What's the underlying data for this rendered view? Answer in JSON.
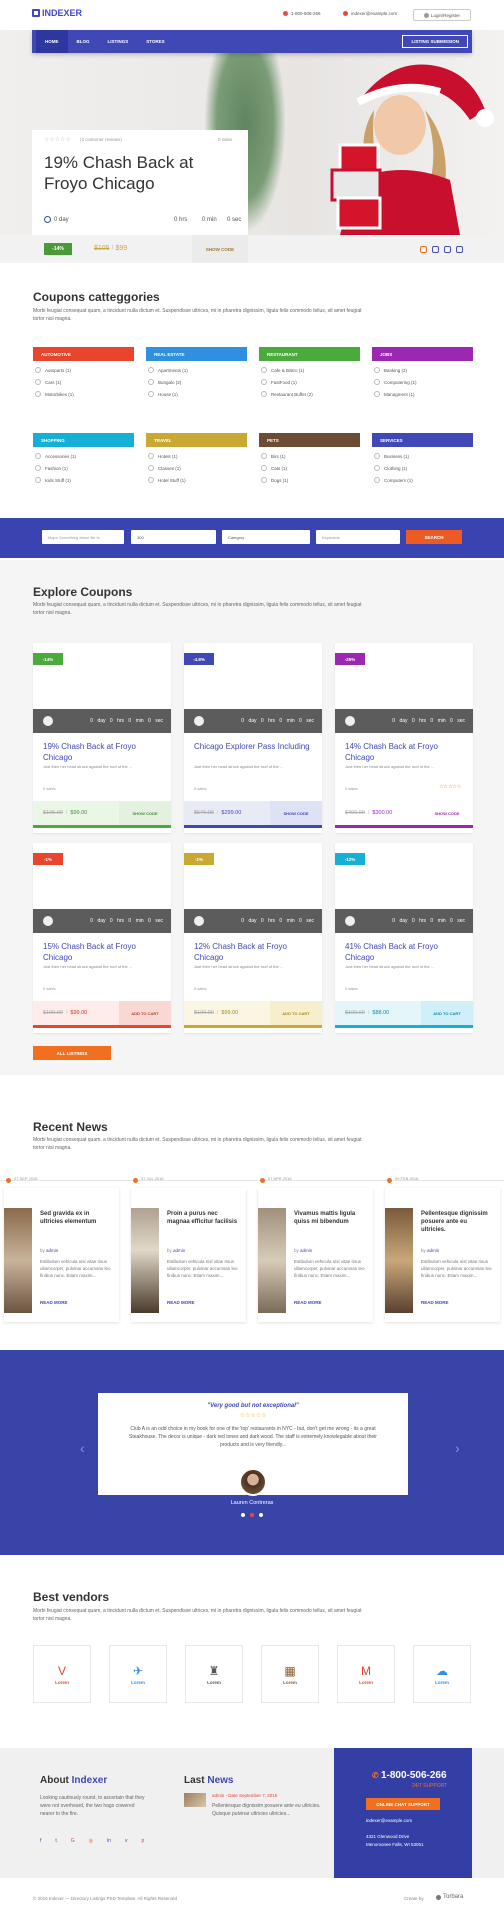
{
  "header": {
    "logo": "INDEXER",
    "phone": "1-800-506-266",
    "email": "indexer@example.com",
    "login": "Login/Register"
  },
  "nav": {
    "items": [
      "HOME",
      "BLOG",
      "LISTINGS",
      "STORES"
    ],
    "listing_button": "LISTING SUBMISSION"
  },
  "hero": {
    "reviews": "(3 customer reviews)",
    "sales": "0 sales",
    "title": "19% Chash Back at Froyo Chicago",
    "days": "0 day",
    "hrs": "0 hrs",
    "min": "0 min",
    "sec": "0 sec",
    "discount": "-14%",
    "old_price": "$105",
    "new_price": "$99",
    "show_code": "SHOW CODE"
  },
  "categories": {
    "title": "Coupons catteggories",
    "text": "Morbi feugiat consequat quam, a tincidunt nulla dictum et. Suspendisse ultrices, mi in pharetra dignissim, ligula felis commodo tellus, sit amet feugiat tortor nisl magna.",
    "groups": [
      {
        "name": "AUTOMOTIVE",
        "color": "#e8452c",
        "items": [
          "Autoparts (1)",
          "Cars (1)",
          "Motorbikes (1)"
        ]
      },
      {
        "name": "REAL ESTATE",
        "color": "#2f8fe0",
        "items": [
          "Apartments (1)",
          "Bungalo (2)",
          "House (1)"
        ]
      },
      {
        "name": "RESTAURANT",
        "color": "#4aaa3c",
        "items": [
          "Cafe & Bistro (1)",
          "FastFood (1)",
          "Restaurant Buffet (2)"
        ]
      },
      {
        "name": "JOBS",
        "color": "#9c27b0",
        "items": [
          "Banking (2)",
          "Computering (1)",
          "Managment (1)"
        ]
      },
      {
        "name": "SHOPPING",
        "color": "#16b0d6",
        "items": [
          "Accessories (1)",
          "Fashion (1)",
          "Kids Stuff (1)"
        ]
      },
      {
        "name": "TRAVEL",
        "color": "#c9a833",
        "items": [
          "Hotels (1)",
          "Classes (1)",
          "Hotel Stuff (1)"
        ]
      },
      {
        "name": "PETS",
        "color": "#6d4c35",
        "items": [
          "Birs (1)",
          "Cats (1)",
          "Dogs (1)"
        ]
      },
      {
        "name": "SERVICES",
        "color": "#3f48b5",
        "items": [
          "Business (1)",
          "Clothing (1)",
          "Computers (1)"
        ]
      }
    ]
  },
  "search": {
    "keyword_ph": "Major Something about Be Is",
    "city": "300",
    "category": "Category",
    "location_ph": "Keywords",
    "button": "SEARCH"
  },
  "explore": {
    "title": "Explore Coupons",
    "text": "Morbi feugiat consequat quam, a tincidunt nulla dictum et. Suspendisse ultrices, mi in pharetra dignissim, ligula felis commodo tellus, sit amet feugiat tortor nisl magna.",
    "all_listings": "ALL LISTINGS",
    "timer": "0 day  0 hrs  0 min  0 sec",
    "desc": "Just then her head struck against the roof of the ...",
    "sales": "0 sales",
    "cards": [
      {
        "badge": "-14%",
        "bcolor": "#4aaa3c",
        "title": "19% Chash Back at Froyo Chicago",
        "old": "$105.00",
        "new": "$99.00",
        "btn": "SHOW CODE",
        "fbg": "#eaf6e6",
        "line": "#4aaa3c",
        "bbg": "#e4f0e0",
        "bcol": "#4a8a3a"
      },
      {
        "badge": "-4.8%",
        "bcolor": "#3f48b5",
        "title": "Chicago Explorer Pass Including",
        "old": "$576.00",
        "new": "$299.00",
        "btn": "SHOW CODE",
        "fbg": "#e8eaf6",
        "line": "#3f48b5",
        "bbg": "#dfe2f4",
        "bcol": "#3f48b5"
      },
      {
        "badge": "-25%",
        "bcolor": "#9c27b0",
        "title": "14% Chash Back at Froyo Chicago",
        "old": "$400.00",
        "new": "$300.00",
        "btn": "SHOW CODE",
        "fbg": "#fff",
        "line": "#9c27b0",
        "bbg": "#fff",
        "bcol": "#9c27b0"
      },
      {
        "badge": "-1%",
        "bcolor": "#e8452c",
        "title": "15% Chash Back at Froyo Chicago",
        "old": "$100.00",
        "new": "$99.00",
        "btn": "ADD TO CART",
        "fbg": "#fdecea",
        "line": "#e8452c",
        "bbg": "#f9d8d4",
        "bcol": "#c0392b"
      },
      {
        "badge": "-1%",
        "bcolor": "#c9a833",
        "title": "12% Chash Back at Froyo Chicago",
        "old": "$100.00",
        "new": "$99.00",
        "btn": "ADD TO CART",
        "fbg": "#fbf6e3",
        "line": "#c9a833",
        "bbg": "#f7eecb",
        "bcol": "#a78a22"
      },
      {
        "badge": "-12%",
        "bcolor": "#16b0d6",
        "title": "41% Chash Back at Froyo Chicago",
        "old": "$100.00",
        "new": "$88.00",
        "btn": "ADD TO CART",
        "fbg": "#e5f6fb",
        "line": "#16b0d6",
        "bbg": "#d1eff8",
        "bcol": "#1189aa"
      }
    ]
  },
  "news": {
    "title": "Recent News",
    "text": "Morbi feugiat consequat quam, a tincidunt nulla dictum et. Suspendisse ultrices, mi in pharetra dignissim, ligula felis commodo tellus, sit amet feugiat tortor nisl magna.",
    "by": "by",
    "author": "admin",
    "read_more": "READ MORE",
    "posts": [
      {
        "date": "07 SEP 2016",
        "title": "Sed gravida ex in ultricies elementum",
        "desc": "Estibulum vehicula nisl vitae risus ullamcorper, pulvinar accumsan leo finibus nunc. Etiam maxim..."
      },
      {
        "date": "07 JUL 2016",
        "title": "Proin a purus nec magnaa efficitur facilisis",
        "desc": "Estibulum vehicula nisl vitae risus ullamcorper, pulvinar accumsan leo finibus nunc. Etiam maxim..."
      },
      {
        "date": "07 APR 2016",
        "title": "Vivamus mattis ligula quiss mi bibendum",
        "desc": "Estibulum vehicula nisl vitae risus ullamcorper, pulvinar accumsan leo finibus nunc. Etiam maxim..."
      },
      {
        "date": "09 FEB 2016",
        "title": "Pellentesque dignissim posuere ante eu ultricies.",
        "desc": "Estibulum vehicula nisl vitae risus ullamcorper, pulvinar accumsan leo finibus nunc. Etiam maxim..."
      }
    ]
  },
  "testimonial": {
    "headline": "\"Very good but not exceptional\"",
    "text": "Club A is an odd choice in my book for one of the 'top' restaurants in NYC - but, don't get me wrong - its a great Steakhouse. The decor is unique - dark red tones and dark wood. The staff is extremely knowlegable about their products and is very friendly...",
    "name": "Lauren Contreras"
  },
  "vendors": {
    "title": "Best vendors",
    "text": "Morbi feugiat consequat quam, a tincidunt nulla dictum et. Suspendisse ultrices, mi in pharetra dignissim, ligula felis commodo tellus, sit amet feugiat tortor nisl magna.",
    "label": "Lorem"
  },
  "footer": {
    "about_title_a": "About ",
    "about_title_b": "Indexer",
    "about_text": "Looking cautiously round, to ascertain that they were not overheard, the two hags cowered nearer to the fire.",
    "news_title_a": "Last ",
    "news_title_b": "News",
    "news_meta": "admin  -  Date September 7, 2016",
    "news_text": "Pellentesque dignissim posuere ante eu ultricies. Quisque pulvinar ultricies ultricies...",
    "phone": "1-800-506-266",
    "support": "24/7 SUPPORT",
    "chat": "ONLINE CHAT SUPPORT",
    "email": "indexer@example.com",
    "address1": "4321 Glenwood Drive",
    "address2": "Menomonee Falls, WI 53051"
  },
  "copyright": {
    "text": "© 2016 Indexer — Directory Listings PSD Template. All Rights Reserved",
    "created": "Create by",
    "brand": "Torbara"
  }
}
